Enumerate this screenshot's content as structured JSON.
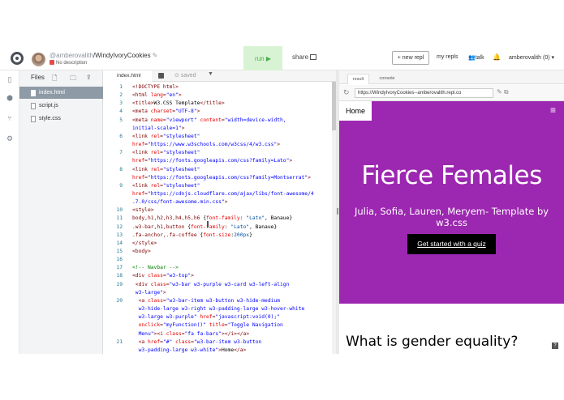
{
  "header": {
    "owner": "@amberovalith",
    "repl_name": "/WindyIvoryCookies",
    "description": "No description",
    "run_label": "run ▶",
    "share_label": "share",
    "new_repl_label": "+ new repl",
    "my_repls_label": "my repls",
    "talk_label": "talk",
    "user_label": "amberovalith (0) ▾"
  },
  "files": {
    "title": "Files",
    "items": [
      "index.html",
      "script.js",
      "style.css"
    ],
    "selected": "index.html"
  },
  "editor": {
    "tab_label": "index.html",
    "status": "saved",
    "lines": [
      {
        "n": "1",
        "parts": [
          [
            "tg",
            "<!DOCTYPE html>"
          ]
        ]
      },
      {
        "n": "2",
        "parts": [
          [
            "tg",
            "<html "
          ],
          [
            "at",
            "lang"
          ],
          [
            "tg",
            "="
          ],
          [
            "sv",
            "\"en\""
          ],
          [
            "tg",
            ">"
          ]
        ]
      },
      {
        "n": "3",
        "parts": [
          [
            "tg",
            "<title>"
          ],
          [
            "",
            "W3.CSS Template"
          ],
          [
            "tg",
            "</title>"
          ]
        ]
      },
      {
        "n": "4",
        "parts": [
          [
            "tg",
            "<meta "
          ],
          [
            "at",
            "charset"
          ],
          [
            "tg",
            "="
          ],
          [
            "sv",
            "\"UTF-8\""
          ],
          [
            "tg",
            ">"
          ]
        ]
      },
      {
        "n": "5",
        "parts": [
          [
            "tg",
            "<meta "
          ],
          [
            "at",
            "name"
          ],
          [
            "tg",
            "="
          ],
          [
            "sv",
            "\"viewport\""
          ],
          [
            "tg",
            " "
          ],
          [
            "at",
            "content"
          ],
          [
            "tg",
            "="
          ],
          [
            "sv",
            "\"width=device-width,"
          ]
        ]
      },
      {
        "n": "",
        "parts": [
          [
            "sv",
            "initial-scale=1\""
          ],
          [
            "tg",
            ">"
          ]
        ]
      },
      {
        "n": "6",
        "parts": [
          [
            "tg",
            "<link "
          ],
          [
            "at",
            "rel"
          ],
          [
            "tg",
            "="
          ],
          [
            "sv",
            "\"stylesheet\""
          ]
        ]
      },
      {
        "n": "",
        "parts": [
          [
            "at",
            "href"
          ],
          [
            "tg",
            "="
          ],
          [
            "sv",
            "\"https://www.w3schools.com/w3css/4/w3.css\""
          ],
          [
            "tg",
            ">"
          ]
        ]
      },
      {
        "n": "7",
        "parts": [
          [
            "tg",
            "<link "
          ],
          [
            "at",
            "rel"
          ],
          [
            "tg",
            "="
          ],
          [
            "sv",
            "\"stylesheet\""
          ]
        ]
      },
      {
        "n": "",
        "parts": [
          [
            "at",
            "href"
          ],
          [
            "tg",
            "="
          ],
          [
            "sv",
            "\"https://fonts.googleapis.com/css?family=Lato\""
          ],
          [
            "tg",
            ">"
          ]
        ]
      },
      {
        "n": "8",
        "parts": [
          [
            "tg",
            "<link "
          ],
          [
            "at",
            "rel"
          ],
          [
            "tg",
            "="
          ],
          [
            "sv",
            "\"stylesheet\""
          ]
        ]
      },
      {
        "n": "",
        "parts": [
          [
            "at",
            "href"
          ],
          [
            "tg",
            "="
          ],
          [
            "sv",
            "\"https://fonts.googleapis.com/css?family=Montserrat\""
          ],
          [
            "tg",
            ">"
          ]
        ]
      },
      {
        "n": "9",
        "parts": [
          [
            "tg",
            "<link "
          ],
          [
            "at",
            "rel"
          ],
          [
            "tg",
            "="
          ],
          [
            "sv",
            "\"stylesheet\""
          ]
        ]
      },
      {
        "n": "",
        "parts": [
          [
            "at",
            "href"
          ],
          [
            "tg",
            "="
          ],
          [
            "sv",
            "\"https://cdnjs.cloudflare.com/ajax/libs/font-awesome/4"
          ]
        ]
      },
      {
        "n": "",
        "parts": [
          [
            "sv",
            ".7.0/css/font-awesome.min.css\""
          ],
          [
            "tg",
            ">"
          ]
        ]
      },
      {
        "n": "10",
        "parts": [
          [
            "tg",
            "<style>"
          ]
        ]
      },
      {
        "n": "11",
        "parts": [
          [
            "tg",
            "body,h1,h2,h3,h4,h5,h6 "
          ],
          [
            "",
            "{"
          ],
          [
            "at",
            "font-family"
          ],
          [
            "",
            ": "
          ],
          [
            "un",
            "\"Lato\""
          ],
          [
            "",
            ", Banaue}"
          ]
        ]
      },
      {
        "n": "12",
        "parts": [
          [
            "tg",
            ".w3-bar,h1,button "
          ],
          [
            "",
            "{"
          ],
          [
            "at",
            "font-family"
          ],
          [
            "",
            ": "
          ],
          [
            "un",
            "\"Lato\""
          ],
          [
            "",
            ", Banaue}"
          ]
        ]
      },
      {
        "n": "13",
        "parts": [
          [
            "tg",
            ".fa-anchor,.fa-coffee "
          ],
          [
            "",
            "{"
          ],
          [
            "at",
            "font-size"
          ],
          [
            "",
            ":"
          ],
          [
            "un",
            "200px"
          ],
          [
            "",
            "}"
          ]
        ]
      },
      {
        "n": "14",
        "parts": [
          [
            "tg",
            "</style>"
          ]
        ]
      },
      {
        "n": "15",
        "parts": [
          [
            "tg",
            "<body>"
          ]
        ]
      },
      {
        "n": "16",
        "parts": [
          [
            "",
            ""
          ]
        ]
      },
      {
        "n": "17",
        "parts": [
          [
            "cm",
            "<!-- Navbar -->"
          ]
        ]
      },
      {
        "n": "18",
        "parts": [
          [
            "tg",
            "<div "
          ],
          [
            "at",
            "class"
          ],
          [
            "tg",
            "="
          ],
          [
            "sv",
            "\"w3-top\""
          ],
          [
            "tg",
            ">"
          ]
        ]
      },
      {
        "n": "19",
        "parts": [
          [
            "tg",
            " <div "
          ],
          [
            "at",
            "class"
          ],
          [
            "tg",
            "="
          ],
          [
            "sv",
            "\"w3-bar w3-purple w3-card w3-left-align"
          ]
        ]
      },
      {
        "n": "",
        "parts": [
          [
            "sv",
            " w3-large\""
          ],
          [
            "tg",
            ">"
          ]
        ]
      },
      {
        "n": "20",
        "parts": [
          [
            "tg",
            "  <a "
          ],
          [
            "at",
            "class"
          ],
          [
            "tg",
            "="
          ],
          [
            "sv",
            "\"w3-bar-item w3-button w3-hide-medium"
          ]
        ]
      },
      {
        "n": "",
        "parts": [
          [
            "sv",
            "  w3-hide-large w3-right w3-padding-large w3-hover-white"
          ]
        ]
      },
      {
        "n": "",
        "parts": [
          [
            "sv",
            "  w3-large w3-purple\""
          ],
          [
            "tg",
            " "
          ],
          [
            "at",
            "href"
          ],
          [
            "tg",
            "="
          ],
          [
            "sv",
            "\"javascript:void(0);\""
          ]
        ]
      },
      {
        "n": "",
        "parts": [
          [
            "at",
            "  onclick"
          ],
          [
            "tg",
            "="
          ],
          [
            "sv",
            "\"myFunction()\""
          ],
          [
            "tg",
            " "
          ],
          [
            "at",
            "title"
          ],
          [
            "tg",
            "="
          ],
          [
            "sv",
            "\"Toggle Navigation"
          ]
        ]
      },
      {
        "n": "",
        "parts": [
          [
            "sv",
            "  Menu\""
          ],
          [
            "tg",
            "><i "
          ],
          [
            "at",
            "class"
          ],
          [
            "tg",
            "="
          ],
          [
            "sv",
            "\"fa fa-bars\""
          ],
          [
            "tg",
            "></i></a>"
          ]
        ]
      },
      {
        "n": "21",
        "parts": [
          [
            "tg",
            "  <a "
          ],
          [
            "at",
            "href"
          ],
          [
            "tg",
            "="
          ],
          [
            "sv",
            "\"#\""
          ],
          [
            "tg",
            " "
          ],
          [
            "at",
            "class"
          ],
          [
            "tg",
            "="
          ],
          [
            "sv",
            "\"w3-bar-item w3-button"
          ]
        ]
      },
      {
        "n": "",
        "parts": [
          [
            "sv",
            "  w3-padding-large w3-white\""
          ],
          [
            "tg",
            ">"
          ],
          [
            "",
            "Home"
          ],
          [
            "tg",
            "</a>"
          ]
        ]
      }
    ]
  },
  "preview": {
    "tabs": [
      "result",
      "console"
    ],
    "active_tab": "result",
    "url": "https://WindyIvoryCookies--amberovalith.repl.co",
    "nav_home": "Home",
    "hero_title": "Fierce Females",
    "hero_subtitle": "Julia, Sofia, Lauren, Meryem- Template by w3.css",
    "hero_button": "Get started with a quiz",
    "section_title": "What is gender equality?",
    "colors": {
      "purple": "#9c27b0",
      "run_bg": "#d8f3d3",
      "run_text": "#4caf50"
    }
  }
}
